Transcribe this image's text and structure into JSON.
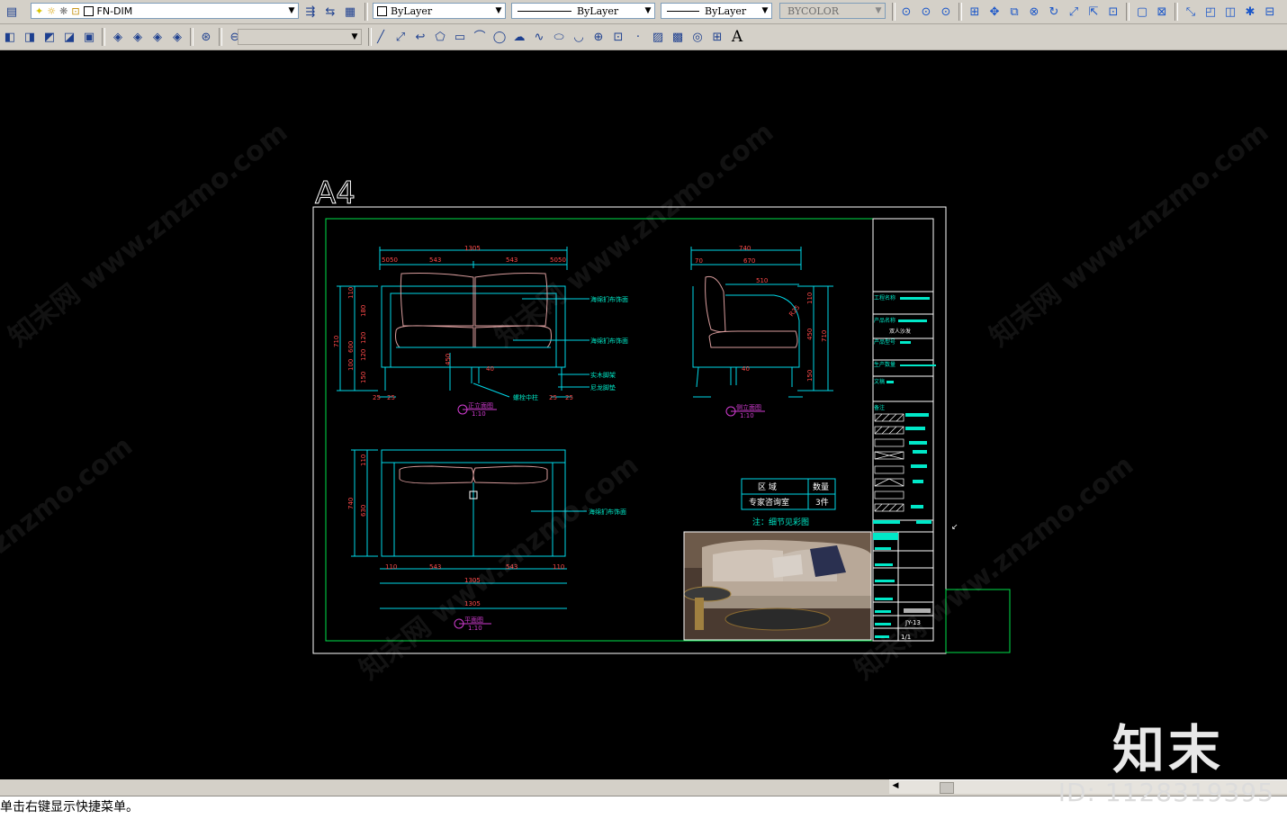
{
  "toolbar": {
    "layer_value": "FN-DIM",
    "color_value": "ByLayer",
    "linetype_value": "ByLayer",
    "lineweight_value": "ByLayer",
    "plotstyle_value": "BYCOLOR",
    "text_tool": "A"
  },
  "drawing": {
    "sheet_label": "A4",
    "front_view": {
      "overall": "1305",
      "segments": [
        "50",
        "50",
        "543",
        "543",
        "50",
        "50"
      ],
      "left_dims": [
        "710",
        "600",
        "110",
        "180",
        "120",
        "100",
        "120",
        "150"
      ],
      "height_450": "450",
      "foot_dims": [
        "25",
        "25",
        "25",
        "25"
      ],
      "seat_h": "40",
      "callouts": [
        "海绵扪布饰面",
        "海绵扪布饰面",
        "实木脚架",
        "尼龙脚垫",
        "螺栓中柱"
      ],
      "view_label": "正立面图",
      "scale": "1:10"
    },
    "side_view": {
      "overall": "740",
      "top_dims": [
        "70",
        "670"
      ],
      "inner": "510",
      "slant": "R25",
      "right_dims": [
        "110",
        "450",
        "150",
        "710"
      ],
      "view_label": "侧立面图",
      "scale": "1:10"
    },
    "plan_view": {
      "overall": "1305",
      "segments": [
        "110",
        "543",
        "543",
        "110"
      ],
      "left_dims": [
        "110",
        "740",
        "630"
      ],
      "callout": "海绵扪布饰面",
      "view_label": "平面图",
      "scale": "1:10"
    },
    "schedule": {
      "headers": [
        "区 域",
        "数量"
      ],
      "row": [
        "专家咨询室",
        "3件"
      ],
      "note": "注：细节见彩图"
    },
    "title_block": {
      "labels": [
        "工程名称",
        "产品名称",
        "双人沙发",
        "产品型号",
        "生产数量",
        "文稿",
        "备注"
      ],
      "drawing_no": "JY-13",
      "sheet": "1/1"
    }
  },
  "statusbar": {
    "command_prompt": "单击右键显示快捷菜单。"
  },
  "watermark": {
    "logo": "知末",
    "id_text": "ID: 1128319395",
    "diag_text": "知末网 www.znzmo.com",
    "diag_text_short": "znzmo.com"
  }
}
